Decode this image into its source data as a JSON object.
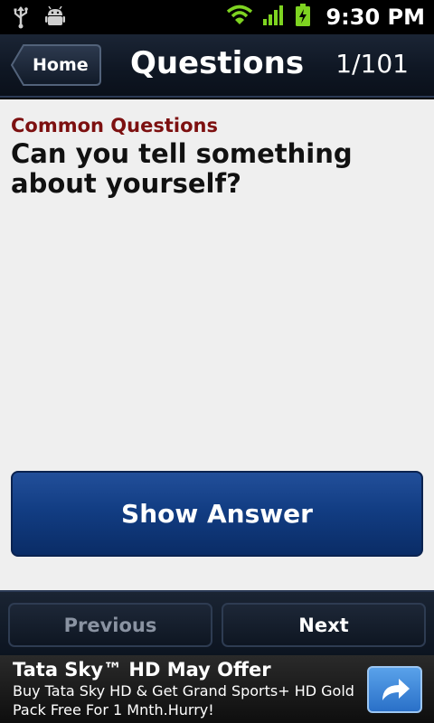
{
  "status_bar": {
    "time": "9:30 PM",
    "icons": [
      "usb-icon",
      "android-debug-icon",
      "wifi-icon",
      "signal-icon",
      "battery-charging-icon"
    ]
  },
  "header": {
    "home_label": "Home",
    "title": "Questions",
    "counter": "1/101"
  },
  "main": {
    "category": "Common Questions",
    "question": "Can you tell something about yourself?",
    "show_answer_label": "Show Answer"
  },
  "nav": {
    "previous_label": "Previous",
    "next_label": "Next"
  },
  "ad": {
    "title": "Tata Sky™ HD May Offer",
    "body": "Buy Tata Sky HD & Get Grand Sports+ HD Gold Pack Free For 1 Mnth.Hurry!",
    "icon": "share-arrow-icon"
  },
  "colors": {
    "category_text": "#7d1010",
    "button_blue": "#123d83",
    "wifi_green": "#7ed321",
    "title_bar": "#0f1724"
  }
}
